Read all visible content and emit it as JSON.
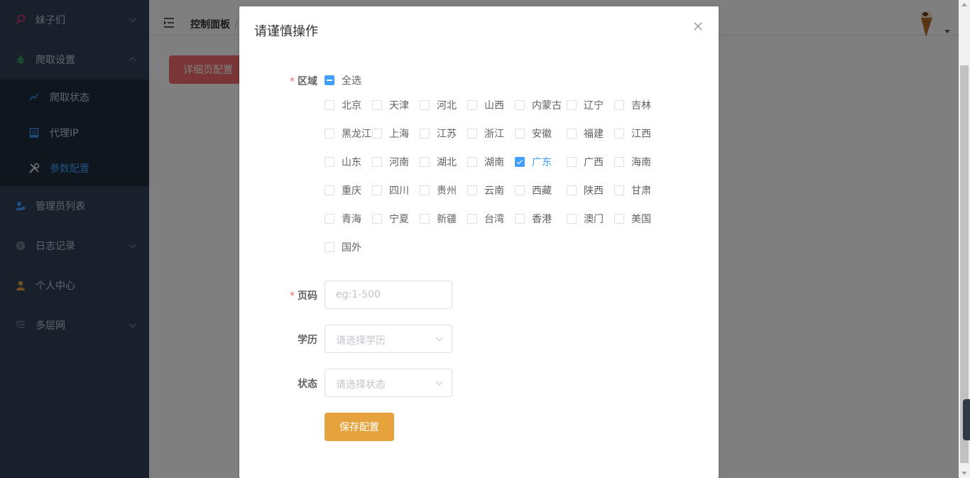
{
  "sidebar": {
    "items": [
      {
        "label": "妹子们",
        "icon": "search-icon",
        "expandable": true
      },
      {
        "label": "爬取设置",
        "icon": "bug-icon",
        "expandable": true,
        "expanded": true
      },
      {
        "label": "管理员列表",
        "icon": "user-group-icon"
      },
      {
        "label": "日志记录",
        "icon": "log-icon",
        "expandable": true
      },
      {
        "label": "个人中心",
        "icon": "person-icon"
      },
      {
        "label": "多层网",
        "icon": "tree-list-icon",
        "expandable": true
      }
    ],
    "submenu": [
      {
        "label": "爬取状态",
        "icon": "chart-line-icon"
      },
      {
        "label": "代理IP",
        "icon": "document-icon"
      },
      {
        "label": "参数配置",
        "icon": "tools-icon",
        "active": true
      }
    ]
  },
  "navbar": {
    "breadcrumb": "控制面板",
    "separator": "/"
  },
  "page": {
    "detail_button": "详细页配置"
  },
  "dialog": {
    "title": "请谨慎操作",
    "region_label": "区域",
    "select_all": "全选",
    "regions": [
      "北京",
      "天津",
      "河北",
      "山西",
      "内蒙古",
      "辽宁",
      "吉林",
      "黑龙江",
      "上海",
      "江苏",
      "浙江",
      "安徽",
      "福建",
      "江西",
      "山东",
      "河南",
      "湖北",
      "湖南",
      "广东",
      "广西",
      "海南",
      "重庆",
      "四川",
      "贵州",
      "云南",
      "西藏",
      "陕西",
      "甘肃",
      "青海",
      "宁夏",
      "新疆",
      "台湾",
      "香港",
      "澳门",
      "美国",
      "国外"
    ],
    "checked_regions": [
      "广东"
    ],
    "page_label": "页码",
    "page_placeholder": "eg:1-500",
    "education_label": "学历",
    "education_placeholder": "请选择学历",
    "status_label": "状态",
    "status_placeholder": "请选择状态",
    "save_button": "保存配置"
  },
  "colors": {
    "sidebar_bg": "#304156",
    "submenu_bg": "#1f2d3d",
    "active": "#409eff",
    "danger": "#f56c6c",
    "warning": "#e6a23c"
  }
}
